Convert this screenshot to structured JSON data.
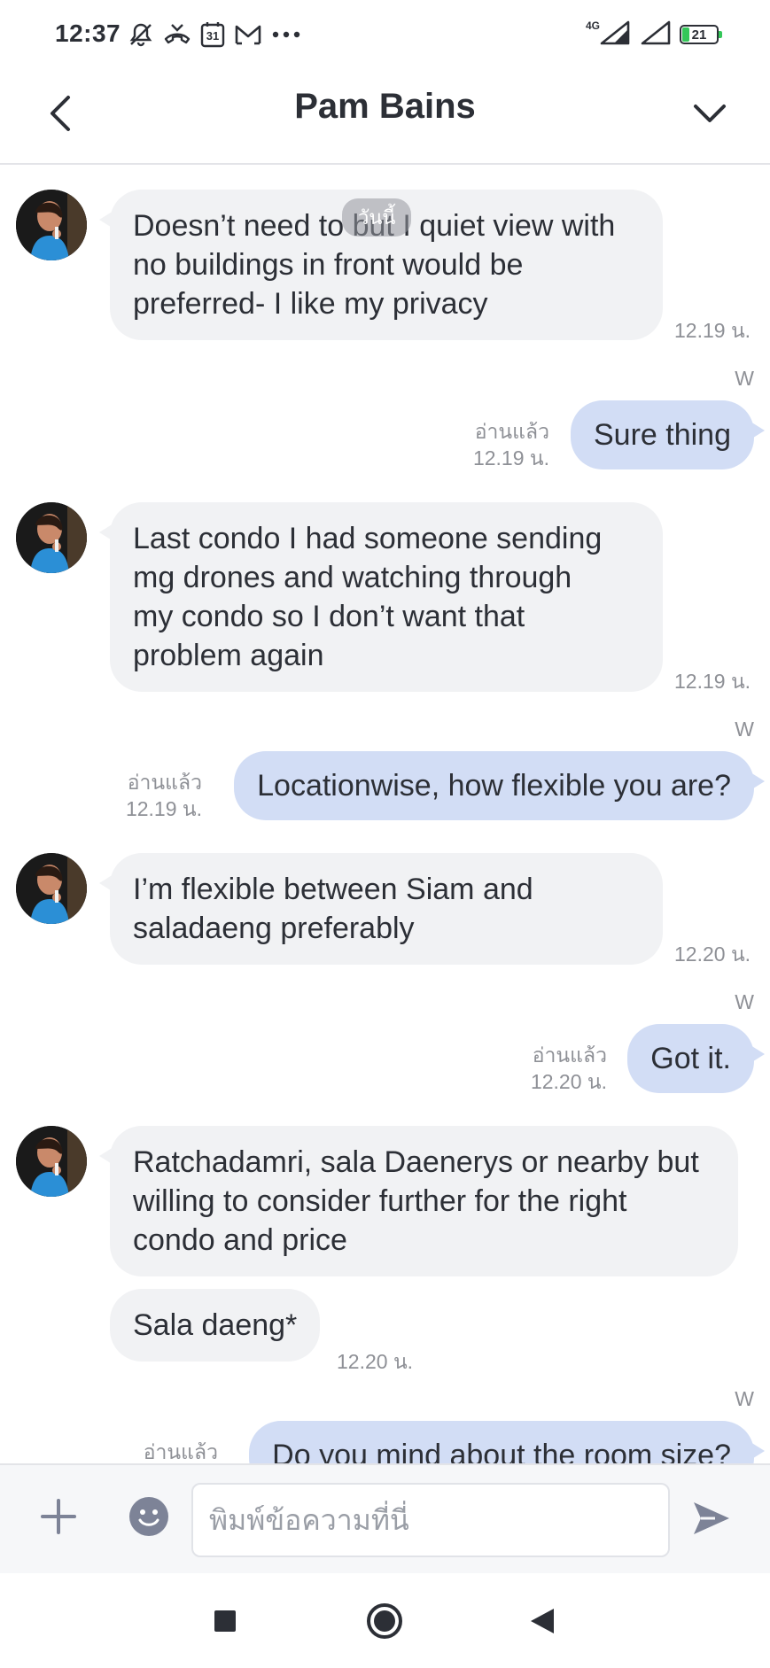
{
  "status_bar": {
    "time": "12:37",
    "icons": [
      "notifications-off-icon",
      "missed-call-icon",
      "calendar-icon",
      "gmail-icon",
      "more-dots-icon"
    ],
    "calendar_day": "31",
    "network": "4G",
    "battery": "21"
  },
  "header": {
    "title": "Pam Bains",
    "back_icon": "chevron-left-icon",
    "menu_icon": "chevron-down-icon"
  },
  "date_chip": "วันนี้",
  "messages": [
    {
      "direction": "in",
      "text": "Doesn’t need to but I quiet view with\nno buildings in front would be\npreferred- I like my privacy",
      "time": "12.19 น."
    },
    {
      "direction": "out",
      "sender_mark": "W",
      "text": "Sure thing",
      "read": "อ่านแล้ว",
      "time": "12.19 น."
    },
    {
      "direction": "in",
      "text": "Last condo I had someone sending\nmg drones and watching through\nmy condo so I don’t want that\nproblem again",
      "time": "12.19 น."
    },
    {
      "direction": "out",
      "sender_mark": "W",
      "text": "Locationwise, how flexible you are?",
      "read": "อ่านแล้ว",
      "time": "12.19 น."
    },
    {
      "direction": "in",
      "text": "I’m flexible between Siam and\nsaladaeng preferably",
      "time": "12.20 น."
    },
    {
      "direction": "out",
      "sender_mark": "W",
      "text": "Got it.",
      "read": "อ่านแล้ว",
      "time": "12.20 น."
    },
    {
      "direction": "in",
      "text": "Ratchadamri, sala Daenerys or nearby but\nwilling to consider further for the right\ncondo and price",
      "time": ""
    },
    {
      "direction": "in",
      "text": "Sala daeng*",
      "time": "12.20 น."
    },
    {
      "direction": "out",
      "sender_mark": "W",
      "text": "Do you mind about the room size?",
      "read": "อ่านแล้ว",
      "time": ""
    }
  ],
  "input_bar": {
    "placeholder": "พิมพ์ข้อความที่นี่",
    "value": "",
    "add_icon": "plus-icon",
    "emoji_icon": "smiley-icon",
    "send_icon": "send-icon"
  },
  "nav_bar": {
    "icons": [
      "recent-apps-icon",
      "home-icon",
      "back-icon"
    ]
  },
  "colors": {
    "incoming_bubble": "#f1f2f4",
    "outgoing_bubble": "#d2ddf5",
    "meta_text": "#8e9096",
    "primary_text": "#2c2f36",
    "icon_accent": "#7d8397"
  }
}
